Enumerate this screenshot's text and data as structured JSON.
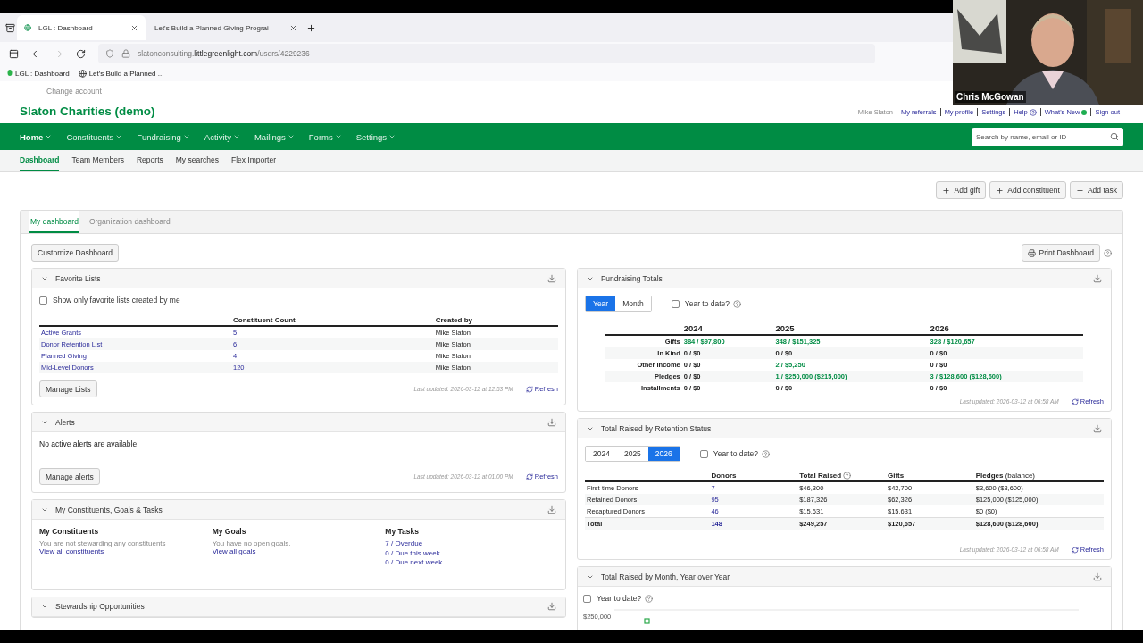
{
  "browser": {
    "tabs": [
      {
        "title": "LGL : Dashboard",
        "selected": true
      },
      {
        "title": "Let's Build a Planned Giving Prograi",
        "selected": false
      }
    ],
    "url_host": "slatonconsulting.",
    "url_domain": "littlegreenlight.com",
    "url_path": "/users/4229236",
    "bookmarks": [
      {
        "label": "LGL : Dashboard",
        "kind": "leaf"
      },
      {
        "label": "Let's Build a Planned ...",
        "kind": "globe"
      }
    ]
  },
  "webcam": {
    "name": "Chris McGowan"
  },
  "header": {
    "change_account": "Change account",
    "org": "Slaton Charities (demo)",
    "user": "Mike Slaton",
    "links": [
      {
        "label": "My referrals",
        "kind": "plain"
      },
      {
        "label": "My profile",
        "kind": "plain"
      },
      {
        "label": "Settings",
        "kind": "plain"
      },
      {
        "label": "Help",
        "kind": "help"
      },
      {
        "label": "What's New",
        "kind": "status"
      },
      {
        "label": "Sign out",
        "kind": "plain"
      }
    ]
  },
  "nav": [
    {
      "label": "Home",
      "selected": true
    },
    {
      "label": "Constituents",
      "selected": false
    },
    {
      "label": "Fundraising",
      "selected": false
    },
    {
      "label": "Activity",
      "selected": false
    },
    {
      "label": "Mailings",
      "selected": false
    },
    {
      "label": "Forms",
      "selected": false
    },
    {
      "label": "Settings",
      "selected": false
    }
  ],
  "search": {
    "placeholder": "Search by name, email or ID"
  },
  "subnav": [
    {
      "label": "Dashboard",
      "selected": true
    },
    {
      "label": "Team Members",
      "selected": false
    },
    {
      "label": "Reports",
      "selected": false
    },
    {
      "label": "My searches",
      "selected": false
    },
    {
      "label": "Flex Importer",
      "selected": false
    }
  ],
  "actions": [
    "Add gift",
    "Add constituent",
    "Add task"
  ],
  "dashboard_tabs": [
    {
      "label": "My dashboard",
      "selected": true
    },
    {
      "label": "Organization dashboard",
      "selected": false
    }
  ],
  "customize": "Customize Dashboard",
  "print": "Print Dashboard",
  "left_panels": [
    {
      "kind": "lists",
      "title": "Favorite Lists",
      "checkbox": {
        "label": "Show only favorite lists created by me",
        "checked": false
      },
      "columns": [
        "Constituent Count",
        "Created by"
      ],
      "rows": [
        {
          "name": "Active Grants",
          "count": "5",
          "creator": "Mike Slaton"
        },
        {
          "name": "Donor Retention List",
          "count": "6",
          "creator": "Mike Slaton"
        },
        {
          "name": "Planned Giving",
          "count": "4",
          "creator": "Mike Slaton"
        },
        {
          "name": "Mid-Level Donors",
          "count": "120",
          "creator": "Mike Slaton"
        }
      ],
      "button": "Manage Lists",
      "updated": "Last updated: 2026-03-12 at 12:53 PM",
      "refresh": "Refresh"
    },
    {
      "kind": "alerts",
      "title": "Alerts",
      "message": "No active alerts are available.",
      "button": "Manage alerts",
      "updated": "Last updated: 2026-03-12 at 01:00 PM",
      "refresh": "Refresh"
    },
    {
      "kind": "mine",
      "title": "My Constituents, Goals & Tasks",
      "sections": [
        {
          "heading": "My Constituents",
          "note": "You are not stewarding any constituents",
          "links": [
            "View all constituents"
          ]
        },
        {
          "heading": "My Goals",
          "note": "You have no open goals.",
          "links": [
            "View all goals"
          ]
        },
        {
          "heading": "My Tasks",
          "links": [
            "7 / Overdue",
            "0 / Due this week",
            "0 / Due next week"
          ]
        }
      ]
    },
    {
      "kind": "header_only",
      "title": "Stewardship Opportunities"
    }
  ],
  "right_panels": [
    {
      "kind": "totals",
      "title": "Fundraising Totals",
      "toggle": [
        {
          "label": "Year",
          "selected": true
        },
        {
          "label": "Month",
          "selected": false
        }
      ],
      "checkbox": {
        "label": "Year to date?",
        "checked": false
      },
      "years": [
        "2024",
        "2025",
        "2026"
      ],
      "rows": [
        {
          "label": "Gifts",
          "cells": [
            {
              "text": "384 / $97,800",
              "link": true
            },
            {
              "text": "348 / $151,325",
              "link": true
            },
            {
              "text": "328 / $120,657",
              "link": true
            }
          ]
        },
        {
          "label": "In Kind",
          "cells": [
            {
              "text": "0 / $0",
              "link": false
            },
            {
              "text": "0 / $0",
              "link": false
            },
            {
              "text": "0 / $0",
              "link": false
            }
          ]
        },
        {
          "label": "Other Income",
          "cells": [
            {
              "text": "0 / $0",
              "link": false
            },
            {
              "text": "2 / $5,250",
              "link": true
            },
            {
              "text": "0 / $0",
              "link": false
            }
          ]
        },
        {
          "label": "Pledges",
          "cells": [
            {
              "text": "0 / $0",
              "link": false
            },
            {
              "text": "1 / $250,000 ($215,000)",
              "link": true
            },
            {
              "text": "3 / $128,600 ($128,600)",
              "link": true
            }
          ]
        },
        {
          "label": "Installments",
          "cells": [
            {
              "text": "0 / $0",
              "link": false
            },
            {
              "text": "0 / $0",
              "link": false
            },
            {
              "text": "0 / $0",
              "link": false
            }
          ]
        }
      ],
      "updated": "Last updated: 2026-03-12 at 06:58 AM",
      "refresh": "Refresh"
    },
    {
      "kind": "retention",
      "title": "Total Raised by Retention Status",
      "toggle": [
        {
          "label": "2024",
          "selected": false
        },
        {
          "label": "2025",
          "selected": false
        },
        {
          "label": "2026",
          "selected": true
        }
      ],
      "checkbox": {
        "label": "Year to date?",
        "checked": false
      },
      "columns": [
        {
          "label": "**Donors**",
          "help": false
        },
        {
          "label": "**Total Raised**",
          "help": true
        },
        {
          "label": "**Gifts**",
          "help": false
        },
        {
          "label": "**Pledges** (balance)",
          "help": false
        }
      ],
      "rows": [
        {
          "kind": "normal",
          "label": "First-time Donors",
          "donors": "7",
          "raised": "$46,300",
          "gifts": "$42,700",
          "pledges": "$3,600 ($3,600)"
        },
        {
          "kind": "normal",
          "label": "Retained Donors",
          "donors": "95",
          "raised": "$187,326",
          "gifts": "$62,326",
          "pledges": "$125,000 ($125,000)"
        },
        {
          "kind": "normal",
          "label": "Recaptured Donors",
          "donors": "46",
          "raised": "$15,631",
          "gifts": "$15,631",
          "pledges": "$0 ($0)"
        },
        {
          "kind": "total",
          "label": "Total",
          "donors": "148",
          "raised": "$249,257",
          "gifts": "$120,657",
          "pledges": "$128,600 ($128,600)"
        }
      ],
      "updated": "Last updated: 2026-03-12 at 06:58 AM",
      "refresh": "Refresh"
    },
    {
      "kind": "monthly",
      "title": "Total Raised by Month, Year over Year",
      "checkbox": {
        "label": "Year to date?",
        "checked": false
      },
      "axis_label": "$250,000"
    }
  ]
}
